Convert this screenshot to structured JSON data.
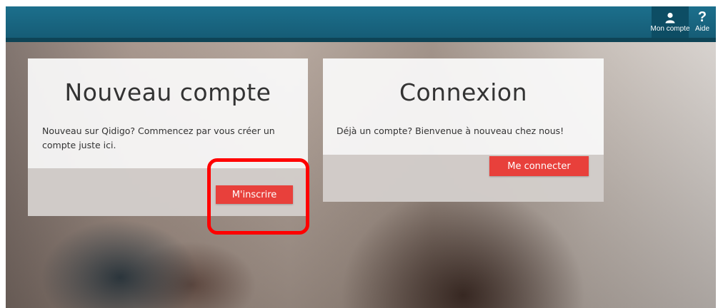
{
  "topbar": {
    "account": {
      "label": "Mon compte",
      "icon": "user-icon"
    },
    "help": {
      "label": "Aide",
      "glyph": "?",
      "icon": "question-mark-icon"
    },
    "color": "#155a73"
  },
  "signup_card": {
    "title": "Nouveau compte",
    "text": "Nouveau sur Qidigo? Commencez par vous créer un compte juste ici.",
    "button_label": "M'inscrire"
  },
  "login_card": {
    "title": "Connexion",
    "text": "Déjà un compte? Bienvenue à nouveau chez nous!",
    "button_label": "Me connecter"
  },
  "colors": {
    "accent_button": "#e8403b",
    "highlight": "#ff0000"
  }
}
